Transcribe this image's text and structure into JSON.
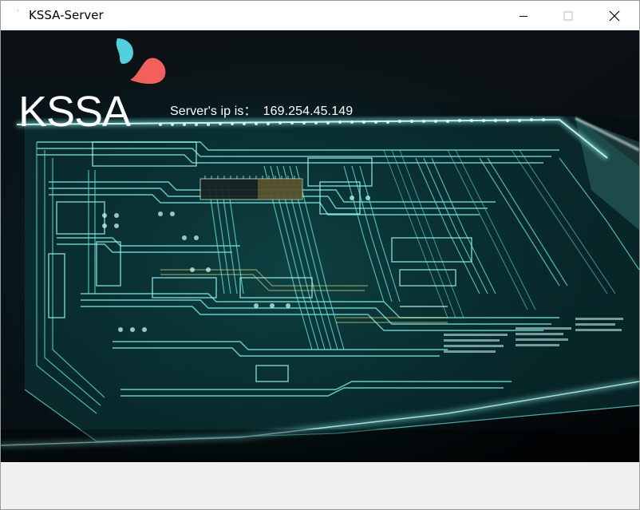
{
  "window": {
    "title": "KSSA-Server",
    "app_icon": "app-icon-glyph"
  },
  "controls": {
    "minimize_icon": "minimize-icon",
    "maximize_icon": "maximize-icon",
    "close_icon": "close-icon"
  },
  "main": {
    "logo_text": "KSSA",
    "server_ip_label": "Server's ip is：",
    "server_ip_value": "169.254.45.149"
  },
  "colors": {
    "logo_teal": "#4fd0dc",
    "logo_coral": "#f25f5c",
    "circuit_glow": "#5ff0e8"
  }
}
